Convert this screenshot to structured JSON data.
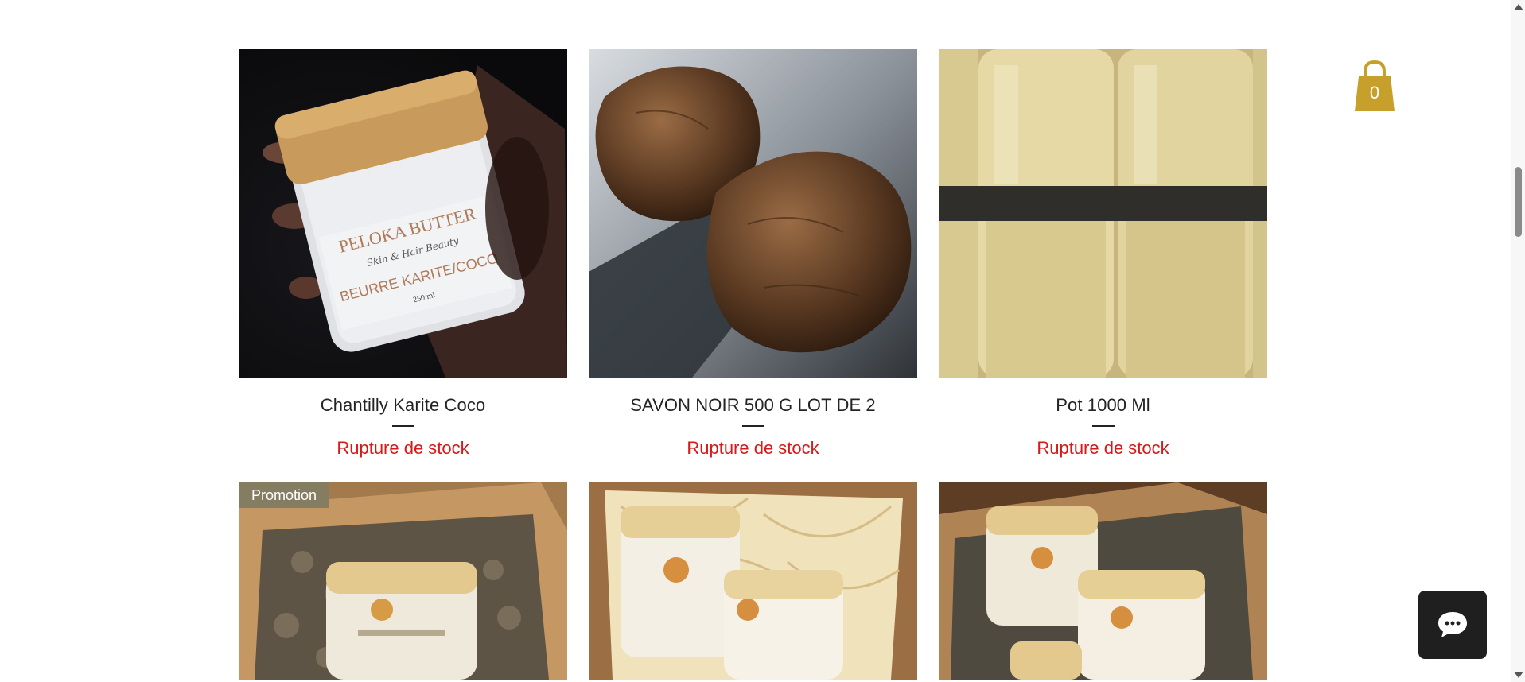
{
  "products": [
    {
      "name": "Chantilly Karite Coco",
      "status": "Rupture de stock",
      "image": "jar-peloka-butter-photo"
    },
    {
      "name": "SAVON NOIR 500 G LOT DE 2",
      "status": "Rupture de stock",
      "image": "black-soap-photo"
    },
    {
      "name": "Pot 1000 Ml",
      "status": "Rupture de stock",
      "image": "shea-jars-photo"
    },
    {
      "badge": "Promotion",
      "image": "gift-box-single-jar-photo"
    },
    {
      "image": "gift-box-two-jars-photo"
    },
    {
      "image": "gift-box-three-jars-photo"
    }
  ],
  "jar_label": {
    "brand": "PELOKA BUTTER",
    "tagline": "Skin & Hair Beauty",
    "product": "BEURRE KARITE/COCO",
    "size": "250 ml"
  },
  "cart": {
    "count": "0",
    "icon": "shopping-bag-icon",
    "color": "#c6a02a"
  },
  "chat": {
    "icon": "chat-bubble-icon"
  },
  "colors": {
    "out_of_stock": "#d61a1a",
    "badge_bg": "#857d62"
  }
}
